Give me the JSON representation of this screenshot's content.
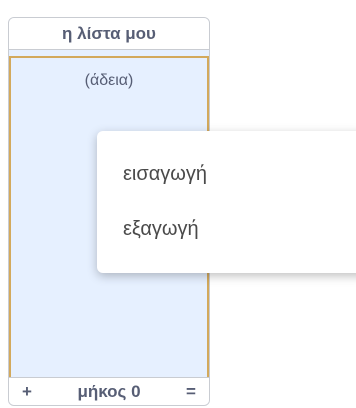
{
  "list_monitor": {
    "title": "η λίστα μου",
    "empty_text": "(άδεια)",
    "add_label": "+",
    "length_label": "μήκος 0",
    "resize_label": "="
  },
  "context_menu": {
    "items": [
      {
        "label": "εισαγωγή"
      },
      {
        "label": "εξαγωγή"
      }
    ]
  },
  "colors": {
    "list_background": "#e6f0ff",
    "list_border_accent": "#d3a95c",
    "text": "#575e75"
  }
}
